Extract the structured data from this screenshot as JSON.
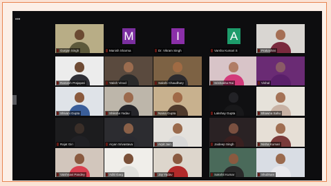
{
  "window": {
    "title": ""
  },
  "colors": {
    "mic_muted": "#e0352b",
    "active_speaker": "#c9e040",
    "screen_bg": "#0d0d0f"
  },
  "participants": [
    {
      "name": "Gunjan Singh",
      "type": "video",
      "bg": "#b8ad86",
      "skin": "#6b4a32",
      "shirt": "#5d5a3c",
      "active": true
    },
    {
      "name": "Manish Sharma",
      "type": "avatar",
      "letter": "M",
      "avatar_color": "#7b2fa0"
    },
    {
      "name": "Dr. Vikram Singh",
      "type": "avatar",
      "letter": "I",
      "avatar_color": "#8a2fa8"
    },
    {
      "name": "Varsha Kumari S",
      "type": "avatar",
      "letter": "A",
      "avatar_color": "#1d9c6b"
    },
    {
      "name": "Prakashini",
      "type": "video",
      "bg": "#d9d6d2",
      "skin": "#a56f55",
      "shirt": "#7a2a3e"
    },
    {
      "name": "Ramesh Prajapati",
      "type": "video",
      "bg": "#ececec",
      "skin": "#6e4b35",
      "shirt": "#2f2f36"
    },
    {
      "name": "Yatish Vinod",
      "type": "video",
      "bg": "#5a4a3e",
      "skin": "#9b6c4f",
      "shirt": "#2a2a2a"
    },
    {
      "name": "Sakshi Chaudhary",
      "type": "video",
      "bg": "#7d6244",
      "skin": "#a06b44",
      "shirt": "#2c2a2e"
    },
    {
      "name": "Srishakha Rai",
      "type": "video",
      "bg": "#d8c4c8",
      "skin": "#b07d66",
      "shirt": "#d23a7a"
    },
    {
      "name": "Vishal",
      "type": "video",
      "bg": "#6a2b74",
      "skin": "#8a5a66",
      "shirt": "#5a1f6a"
    },
    {
      "name": "Shivani Gupta",
      "type": "video",
      "bg": "#dfe3e8",
      "skin": "#8a5a3e",
      "shirt": "#3a5e9a"
    },
    {
      "name": "Shiksha Yadav",
      "type": "video",
      "bg": "#bdb6aa",
      "skin": "#9b6a4d",
      "shirt": "#25252a"
    },
    {
      "name": "Naina Gupta",
      "type": "video",
      "bg": "#c8b18e",
      "skin": "#a06a48",
      "shirt": "#4f3a2c"
    },
    {
      "name": "Lakshay Gupta",
      "type": "video",
      "bg": "#101012",
      "skin": "#222226",
      "shirt": "#18181a"
    },
    {
      "name": "Bhawna Sahu",
      "type": "video",
      "bg": "#e6e2da",
      "skin": "#a47256",
      "shirt": "#c8b2a4"
    },
    {
      "name": "Rajat Giri",
      "type": "video",
      "bg": "#1c1c1e",
      "skin": "#3a2e28",
      "shirt": "#202024"
    },
    {
      "name": "Aryan Srivastava",
      "type": "video",
      "bg": "#2c2c30",
      "skin": "#8a6048",
      "shirt": "#2a2a30"
    },
    {
      "name": "Arpit Jain",
      "type": "video",
      "bg": "#e4e1dc",
      "skin": "#9a6a4c",
      "shirt": "#d8d8d8"
    },
    {
      "name": "Jaideep Singh",
      "type": "video",
      "bg": "#2a2224",
      "skin": "#7a5040",
      "shirt": "#3a2020"
    },
    {
      "name": "Nisha Kumari",
      "type": "video",
      "bg": "#e6dfd6",
      "skin": "#a06e52",
      "shirt": "#7a3a3a"
    },
    {
      "name": "Vaishnavi Pandey",
      "type": "video",
      "bg": "#d2c6bc",
      "skin": "#8a5a40",
      "shirt": "#d84050"
    },
    {
      "name": "Aditi Garg",
      "type": "video",
      "bg": "#f0eeea",
      "skin": "#7a5038",
      "shirt": "#e0e0dc"
    },
    {
      "name": "Jay Yadav",
      "type": "video",
      "bg": "#ddd6cc",
      "skin": "#8a5a40",
      "shirt": "#b22a2a"
    },
    {
      "name": "Sakshit Kumar",
      "type": "video",
      "bg": "#4a6a5a",
      "skin": "#8a5a40",
      "shirt": "#2a2a2a"
    },
    {
      "name": "Shubham",
      "type": "video",
      "bg": "#d9dde4",
      "skin": "#9a6a4e",
      "shirt": "#e8e8ec"
    }
  ]
}
